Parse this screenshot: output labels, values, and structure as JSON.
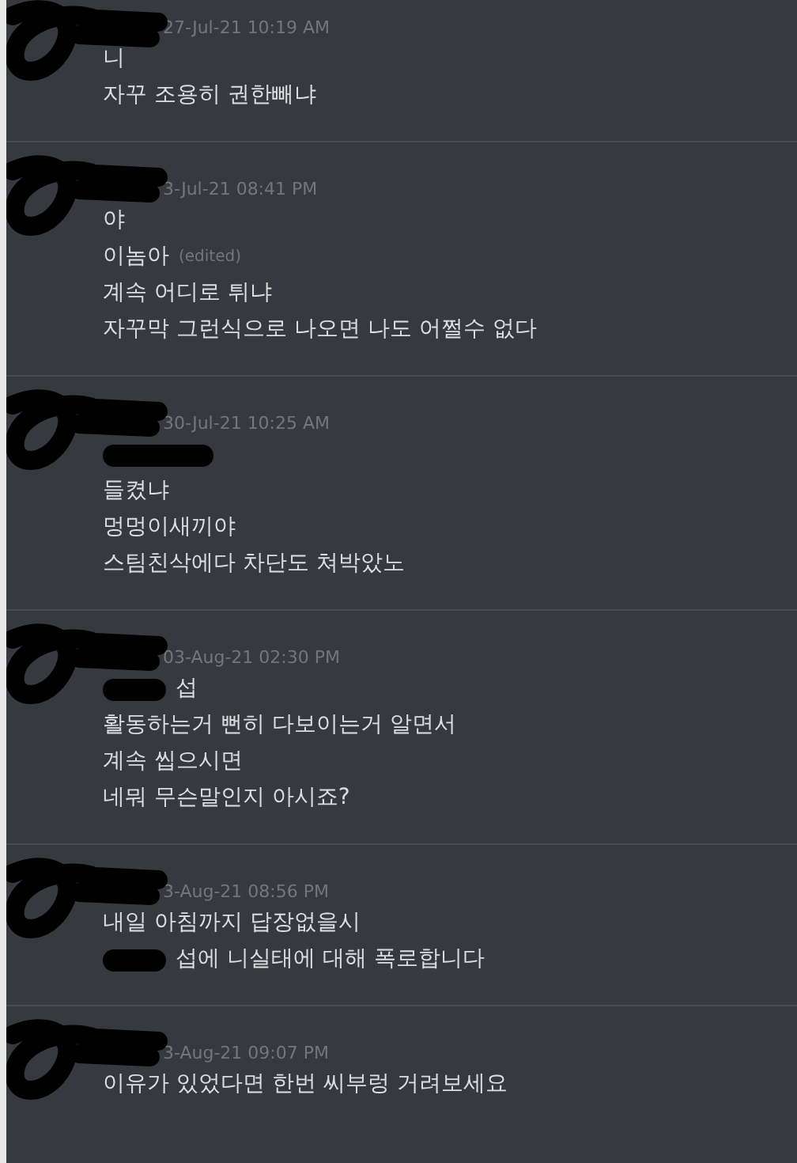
{
  "messages": [
    {
      "timestamp": "27-Jul-21 10:19 AM",
      "lines": [
        {
          "kind": "text",
          "text": "니"
        },
        {
          "kind": "text",
          "text": "자꾸 조용히 권한빼냐"
        }
      ]
    },
    {
      "timestamp": "3-Jul-21 08:41 PM",
      "lines": [
        {
          "kind": "text",
          "text": "야"
        },
        {
          "kind": "text",
          "text": "이놈아",
          "edited": "(edited)"
        },
        {
          "kind": "text",
          "text": "계속 어디로 튀냐"
        },
        {
          "kind": "text",
          "text": "자꾸막 그런식으로 나오면 나도 어쩔수 없다"
        }
      ]
    },
    {
      "timestamp": "30-Jul-21 10:25 AM",
      "lines": [
        {
          "kind": "redacted"
        },
        {
          "kind": "text",
          "text": "들켰냐"
        },
        {
          "kind": "text",
          "text": "멍멍이새끼야"
        },
        {
          "kind": "text",
          "text": "스팀친삭에다 차단도 쳐박았노"
        }
      ]
    },
    {
      "timestamp": "03-Aug-21 02:30 PM",
      "lines": [
        {
          "kind": "partly_redacted",
          "text": "섭"
        },
        {
          "kind": "text",
          "text": "활동하는거 뻔히 다보이는거 알면서"
        },
        {
          "kind": "text",
          "text": "계속 씹으시면"
        },
        {
          "kind": "text",
          "text": "네뭐 무슨말인지 아시죠?"
        }
      ]
    },
    {
      "timestamp": "3-Aug-21 08:56 PM",
      "lines": [
        {
          "kind": "text",
          "text": "내일 아침까지 답장없을시"
        },
        {
          "kind": "partly_redacted",
          "text": "섭에 니실태에 대해 폭로합니다"
        }
      ]
    },
    {
      "timestamp": "3-Aug-21 09:07 PM",
      "lines": [
        {
          "kind": "text",
          "text": "이유가 있었다면 한번 씨부렁 거려보세요"
        }
      ]
    }
  ]
}
